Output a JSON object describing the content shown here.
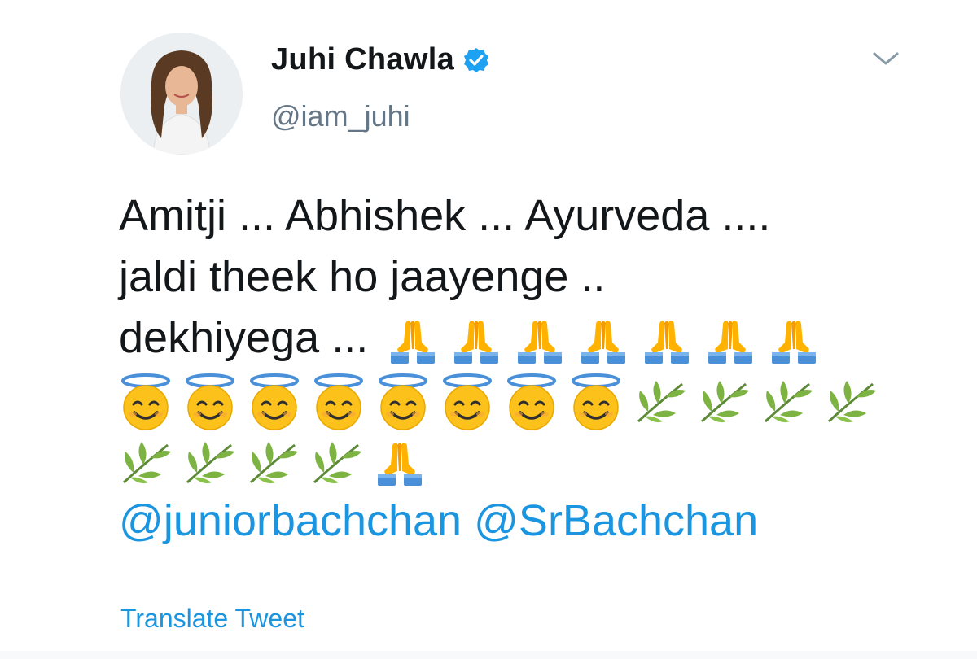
{
  "author": {
    "name": "Juhi Chawla",
    "handle": "@iam_juhi",
    "avatar_icon": "profile-photo-woman",
    "verified_icon": "verified-badge-icon"
  },
  "tweet": {
    "line1": "Amitji ... Abhishek ... Ayurveda ....",
    "line2": "jaldi theek ho jaayenge ..",
    "line3_text": "dekhiyega ...",
    "emoji_names": {
      "pray": "folded-hands-emoji",
      "smile": "smiling-face-with-halo-emoji",
      "leaf": "herb-emoji"
    },
    "mentions": [
      "@juniorbachchan",
      "@SrBachchan"
    ]
  },
  "translate_label": "Translate Tweet",
  "colors": {
    "link": "#1b95e0",
    "secondary_text": "#657786",
    "primary_text": "#14171a",
    "verified": "#1da1f2"
  }
}
